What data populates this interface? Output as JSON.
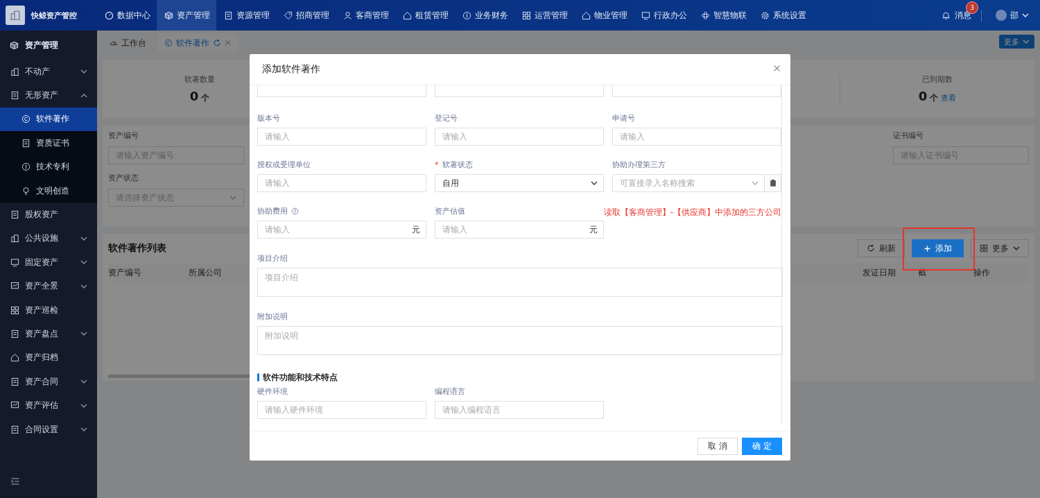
{
  "app": {
    "logo_text": "快鲸资产管控"
  },
  "top_nav": [
    {
      "label": "数据中心",
      "selected": false
    },
    {
      "label": "资产管理",
      "selected": true
    },
    {
      "label": "资源管理",
      "selected": false
    },
    {
      "label": "招商管理",
      "selected": false
    },
    {
      "label": "客商管理",
      "selected": false
    },
    {
      "label": "租赁管理",
      "selected": false
    },
    {
      "label": "业务财务",
      "selected": false
    },
    {
      "label": "运营管理",
      "selected": false
    },
    {
      "label": "物业管理",
      "selected": false
    },
    {
      "label": "行政办公",
      "selected": false
    },
    {
      "label": "智慧物联",
      "selected": false
    },
    {
      "label": "系统设置",
      "selected": false
    }
  ],
  "header_right": {
    "messages": "消息",
    "message_count": "3",
    "user": "邵"
  },
  "sidebar": {
    "title": "资产管理",
    "items": [
      {
        "label": "不动产",
        "kind": "group",
        "expanded": false,
        "selected": false
      },
      {
        "label": "无形资产",
        "kind": "group",
        "expanded": true,
        "selected": false,
        "children": [
          {
            "label": "软件著作",
            "selected": true
          },
          {
            "label": "资质证书",
            "selected": false
          },
          {
            "label": "技术专利",
            "selected": false
          },
          {
            "label": "文明创造",
            "selected": false
          }
        ]
      },
      {
        "label": "股权资产",
        "kind": "link",
        "selected": false
      },
      {
        "label": "公共设施",
        "kind": "group",
        "expanded": false,
        "selected": false
      },
      {
        "label": "固定资产",
        "kind": "group",
        "expanded": false,
        "selected": false
      },
      {
        "label": "资产全景",
        "kind": "group",
        "expanded": false,
        "selected": false
      },
      {
        "label": "资产巡检",
        "kind": "link",
        "selected": false
      },
      {
        "label": "资产盘点",
        "kind": "group",
        "expanded": false,
        "selected": false
      },
      {
        "label": "资产归档",
        "kind": "link",
        "selected": false
      },
      {
        "label": "资产合同",
        "kind": "group",
        "expanded": false,
        "selected": false
      },
      {
        "label": "资产评估",
        "kind": "group",
        "expanded": false,
        "selected": false
      },
      {
        "label": "合同设置",
        "kind": "group",
        "expanded": false,
        "selected": false
      }
    ]
  },
  "tabs": [
    {
      "label": "工作台",
      "selected": false
    },
    {
      "label": "软件著作",
      "selected": true
    }
  ],
  "tabs_more": "更多",
  "stats": [
    {
      "label": "软著数量",
      "value": "0",
      "unit": "个"
    },
    {
      "label": "已到期数",
      "value": "0",
      "unit": "个",
      "link": "查看"
    }
  ],
  "filters_left": [
    {
      "label": "资产编号",
      "placeholder": "请输入资产编号",
      "kind": "input"
    },
    {
      "label": "资产状态",
      "placeholder": "请选择资产状态",
      "kind": "select"
    }
  ],
  "filters_right": [
    {
      "label": "证书编号",
      "placeholder": "请输入证书编号",
      "kind": "input"
    }
  ],
  "list": {
    "title": "软件著作列表",
    "buttons": [
      {
        "label": "刷新",
        "kind": "refresh"
      },
      {
        "label": "添加",
        "kind": "add"
      },
      {
        "label": "更多",
        "kind": "more"
      }
    ],
    "columns_left": [
      "资产编号",
      "所属公司"
    ],
    "columns_right": [
      "发证日期",
      "截",
      "操作"
    ]
  },
  "modal": {
    "title": "添加软件著作",
    "rows": [
      [
        {
          "label": "版本号",
          "placeholder": "请输入",
          "kind": "input"
        },
        {
          "label": "登记号",
          "placeholder": "请输入",
          "kind": "input"
        },
        {
          "label": "申请号",
          "placeholder": "请输入",
          "kind": "input"
        }
      ],
      [
        {
          "label": "授权或受理单位",
          "placeholder": "请输入",
          "kind": "input"
        },
        {
          "label": "软著状态",
          "value": "自用",
          "kind": "select",
          "required_mark": "*"
        },
        {
          "label": "协助办理第三方",
          "placeholder": "可直接录入名称搜索",
          "kind": "select-button"
        }
      ],
      [
        {
          "label": "协助费用",
          "placeholder": "请输入",
          "kind": "suffix",
          "suffix": "元",
          "help": true
        },
        {
          "label": "资产估值",
          "placeholder": "请输入",
          "kind": "suffix",
          "suffix": "元"
        },
        {
          "kind": "note",
          "text": "读取【客商管理】-【供应商】中添加的三方公司"
        }
      ]
    ],
    "textareas": [
      {
        "label": "项目介绍",
        "placeholder": "项目介绍"
      },
      {
        "label": "附加说明",
        "placeholder": "附加说明"
      }
    ],
    "section_title": "软件功能和技术特点",
    "section_fields": [
      {
        "label": "硬件环境",
        "placeholder": "请输入硬件环境"
      },
      {
        "label": "编程语言",
        "placeholder": "请输入编程语言"
      }
    ],
    "buttons": [
      {
        "label": "取 消",
        "kind": "default"
      },
      {
        "label": "确 定",
        "kind": "primary"
      }
    ]
  }
}
